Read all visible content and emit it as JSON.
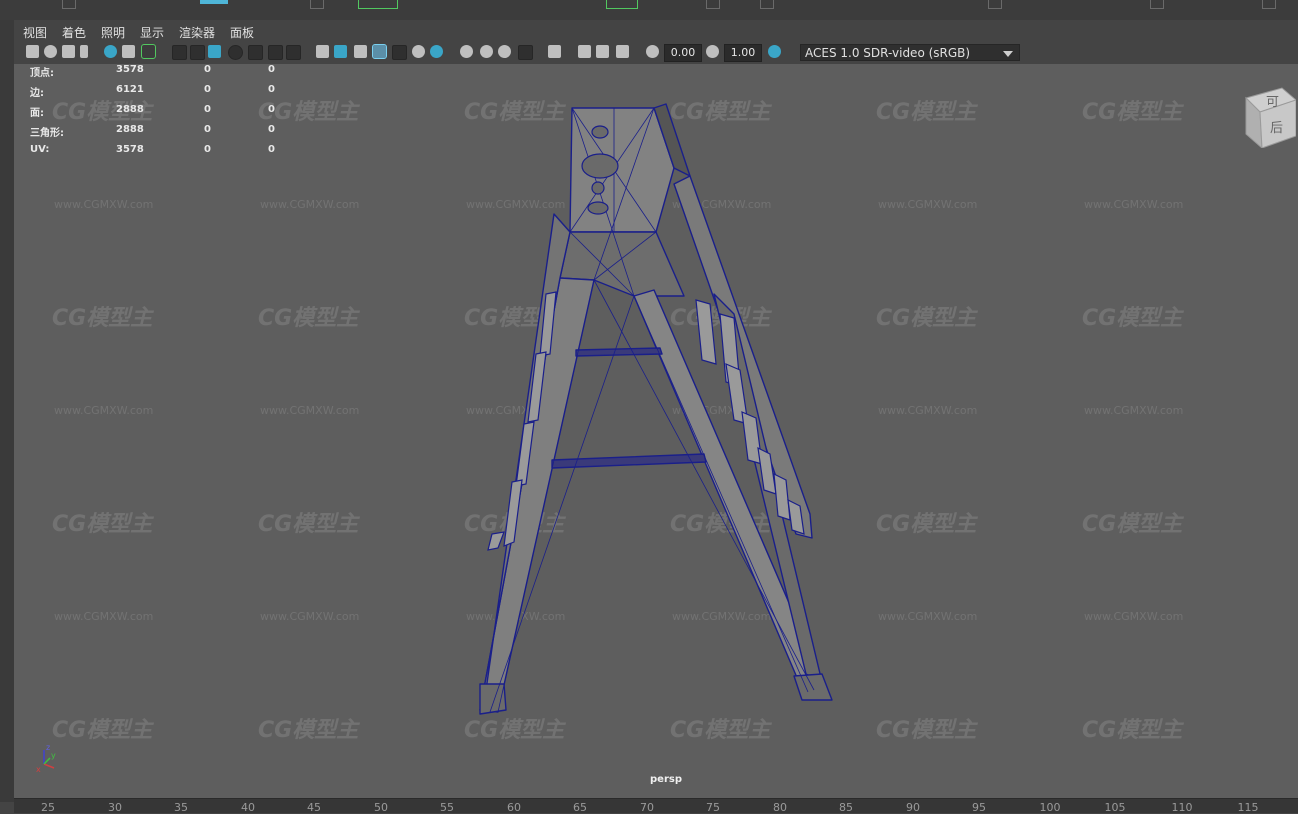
{
  "menu": [
    "视图",
    "着色",
    "照明",
    "显示",
    "渲染器",
    "面板"
  ],
  "toolbar": {
    "exposure": "0.00",
    "gamma": "1.00",
    "color_management_label": "ACES 1.0 SDR-video (sRGB)",
    "icons": [
      "camera-select-icon",
      "camera-lock-icon",
      "bookmark-icon",
      "image-plane-icon",
      "2d-pan-zoom-icon",
      "grease-pencil-icon",
      "grid-icon",
      "film-gate-icon",
      "resolution-gate-icon",
      "gate-mask-icon",
      "field-chart-icon",
      "safe-action-icon",
      "safe-title-icon",
      "wireframe-icon",
      "smooth-shade-icon",
      "use-default-material-icon",
      "wireframe-on-shaded-icon",
      "xray-icon",
      "textured-icon",
      "use-all-lights-icon",
      "shadows-icon",
      "screen-space-ao-icon",
      "motion-blur-icon",
      "multisample-aa-icon",
      "depth-of-field-icon",
      "isolate-select-icon",
      "xray-joints-icon",
      "xray-active-icon",
      "exposure-icon",
      "gamma-icon",
      "color-management-icon"
    ]
  },
  "hud_stats": {
    "rows": [
      {
        "label": "顶点:",
        "values": [
          "3578",
          "0",
          "0"
        ]
      },
      {
        "label": "边:",
        "values": [
          "6121",
          "0",
          "0"
        ]
      },
      {
        "label": "面:",
        "values": [
          "2888",
          "0",
          "0"
        ]
      },
      {
        "label": "三角形:",
        "values": [
          "2888",
          "0",
          "0"
        ]
      },
      {
        "label": "UV:",
        "values": [
          "3578",
          "0",
          "0"
        ]
      }
    ]
  },
  "viewcube": {
    "top_label": "可",
    "side_label": "后"
  },
  "camera_label": "persp",
  "watermark": {
    "logo_text": "CG模型主",
    "url": "www.CGMXW.com"
  },
  "axis": {
    "x": "x",
    "y": "y",
    "z": "z"
  },
  "timeline_ruler": [
    "25",
    "30",
    "35",
    "40",
    "45",
    "50",
    "55",
    "60",
    "65",
    "70",
    "75",
    "80",
    "85",
    "90",
    "95",
    "100",
    "105",
    "110",
    "115"
  ],
  "colors": {
    "viewport_bg": "#5e5e5e",
    "wireframe": "#1a1f8a",
    "mesh_fill": "#7a7a7a",
    "accent_green": "#52c860"
  }
}
